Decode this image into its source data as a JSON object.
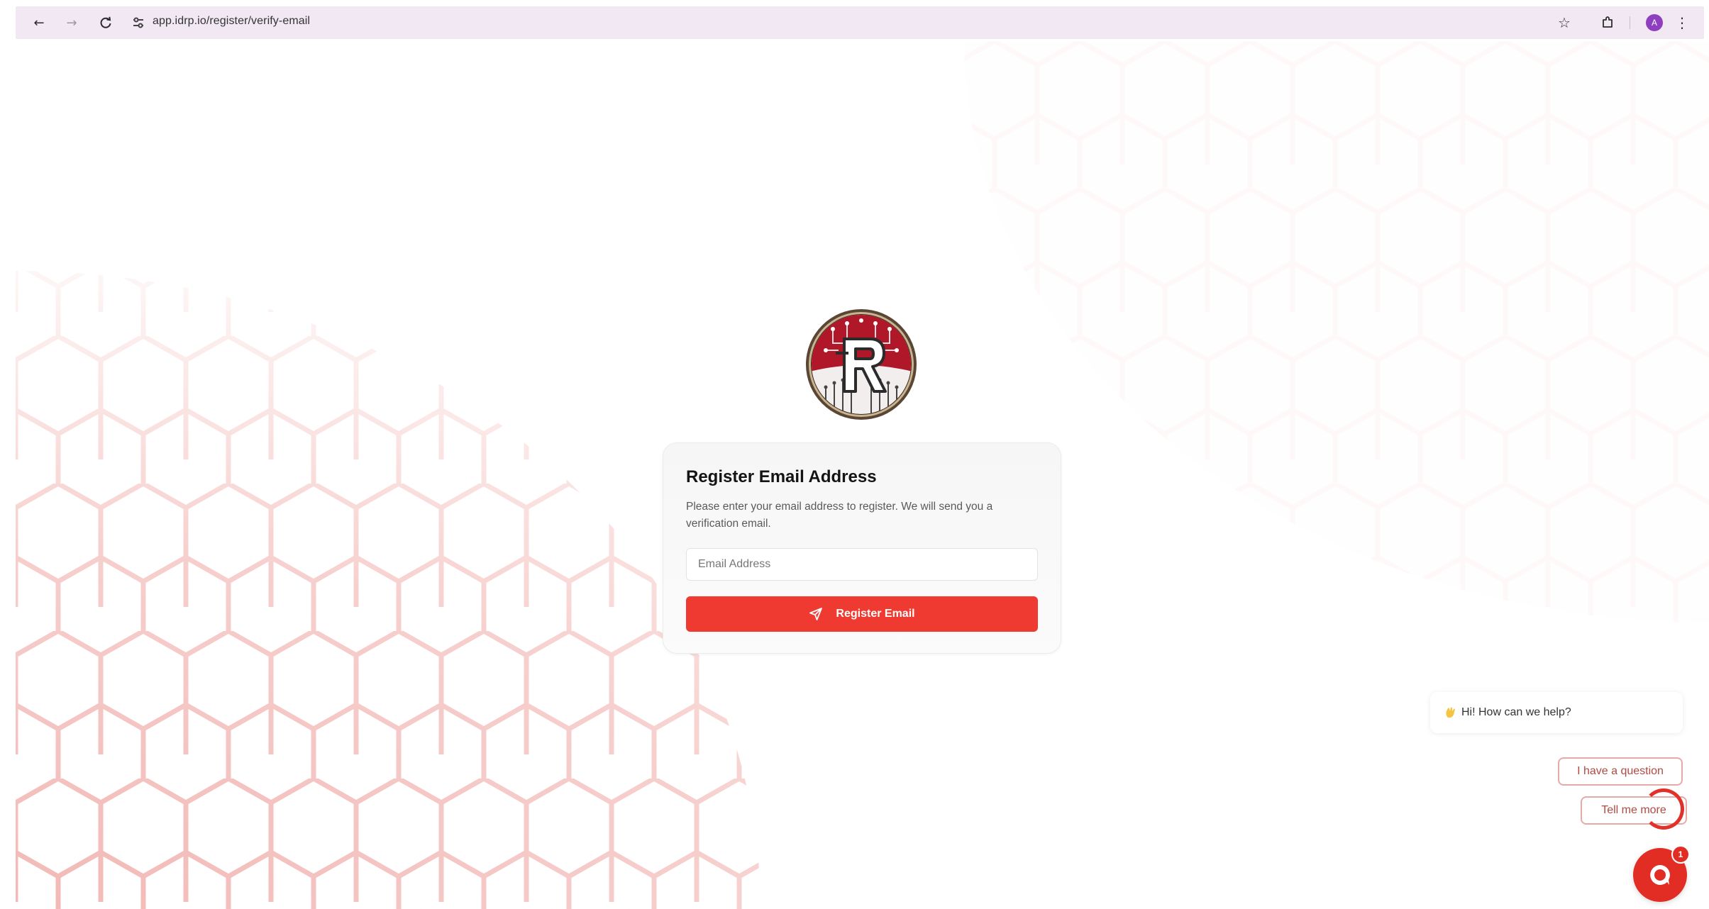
{
  "browser": {
    "url": "app.idrp.io/register/verify-email",
    "profile_initial": "A",
    "icons": {
      "back": "arrow-left-icon",
      "forward": "arrow-right-icon",
      "reload": "reload-icon",
      "site_info": "tune-icon",
      "bookmark": "star-icon",
      "extensions": "puzzle-icon",
      "menu": "kebab-menu-icon"
    }
  },
  "brand": {
    "logo_icon": "idrp-r-logo",
    "logo_letter": "R",
    "primary_color": "#ee3a31",
    "accent_color": "#9c1b27"
  },
  "register": {
    "title": "Register Email Address",
    "description": "Please enter your email address to register. We will send you a verification email.",
    "email_placeholder": "Email Address",
    "email_value": "",
    "button_label": "Register Email",
    "button_icon": "send-icon"
  },
  "chat": {
    "greeting_icon": "waving-hand-icon",
    "greeting": "Hi! How can we help?",
    "options": [
      "I have a question",
      "Tell me more"
    ],
    "launcher_icon": "chat-bubble-icon",
    "unread_count": "1"
  }
}
